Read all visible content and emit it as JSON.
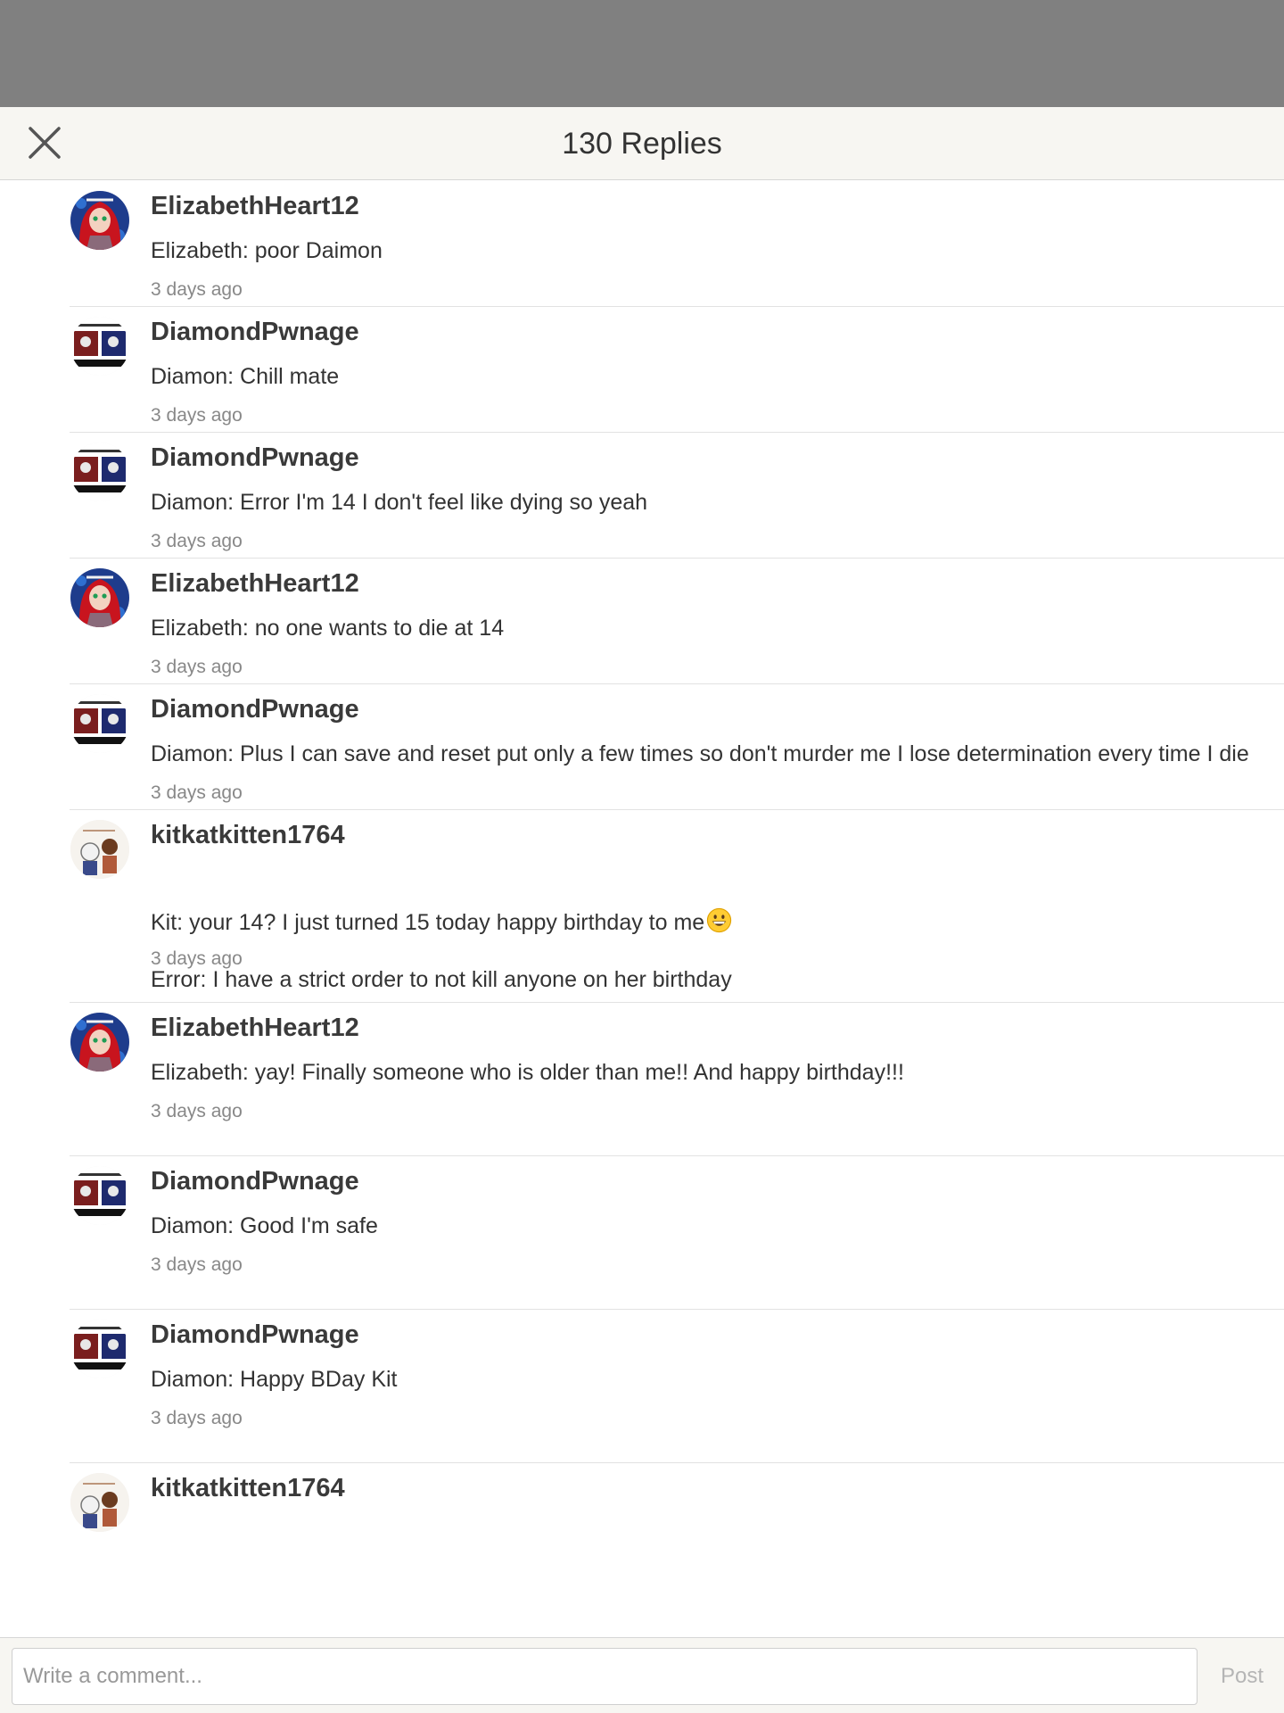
{
  "header": {
    "title": "130 Replies"
  },
  "replies": [
    {
      "username": "ElizabethHeart12",
      "text": "Elizabeth: poor Daimon",
      "time": "3 days ago",
      "avatar": "elizabeth"
    },
    {
      "username": "DiamondPwnage",
      "text": "Diamon: Chill mate",
      "time": "3 days ago",
      "avatar": "diamond"
    },
    {
      "username": "DiamondPwnage",
      "text": "Diamon: Error I'm 14 I don't feel like dying so yeah",
      "time": "3 days ago",
      "avatar": "diamond"
    },
    {
      "username": "ElizabethHeart12",
      "text": "Elizabeth: no one wants to die at 14",
      "time": "3 days ago",
      "avatar": "elizabeth"
    },
    {
      "username": "DiamondPwnage",
      "text": "Diamon: Plus I can save and reset put only a few times so don't murder me I lose determination every time I die",
      "time": "3 days ago",
      "avatar": "diamond"
    },
    {
      "username": "kitkatkitten1764",
      "text": "Kit: your 14? I just turned 15 today happy birthday to me",
      "text2": "Error: I have a strict order to not kill anyone on her birthday",
      "emoji": "grinning-face-emoji",
      "time": "3 days ago",
      "avatar": "kitkat"
    },
    {
      "username": "ElizabethHeart12",
      "text": "Elizabeth: yay! Finally someone who is older than me!! And happy birthday!!!",
      "time": "3 days ago",
      "avatar": "elizabeth"
    },
    {
      "username": "DiamondPwnage",
      "text": "Diamon: Good I'm safe",
      "time": "3 days ago",
      "avatar": "diamond"
    },
    {
      "username": "DiamondPwnage",
      "text": "Diamon: Happy BDay Kit",
      "time": "3 days ago",
      "avatar": "diamond"
    },
    {
      "username": "kitkatkitten1764",
      "text": "",
      "time": "",
      "avatar": "kitkat"
    }
  ],
  "composer": {
    "placeholder": "Write a comment...",
    "post_label": "Post"
  },
  "colors": {
    "overlay": "#808080",
    "header_bg": "#f7f6f2",
    "username": "#3a3a3a",
    "timestamp": "#888888",
    "post_disabled": "#b5b5b5"
  }
}
